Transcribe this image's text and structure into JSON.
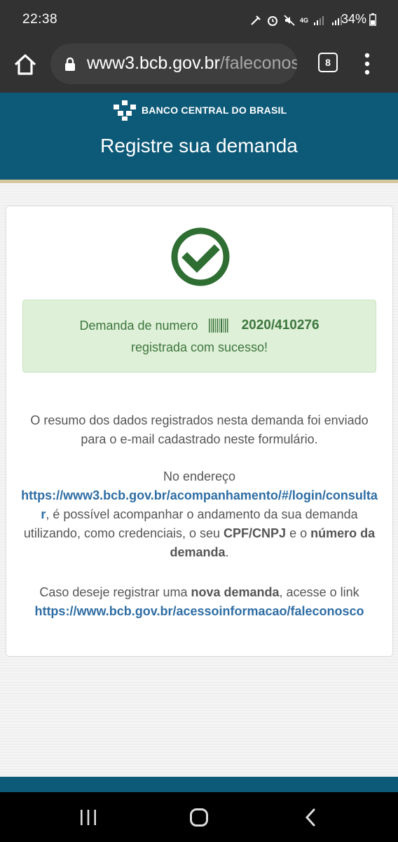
{
  "status": {
    "time": "22:38",
    "battery": "34%",
    "network": "4G"
  },
  "browser": {
    "url_host": "www3.bcb.gov.br",
    "url_path": "/faleconosco",
    "tab_count": "8"
  },
  "header": {
    "logo_text": "BANCO CENTRAL DO BRASIL",
    "title": "Registre sua demanda"
  },
  "alert": {
    "prefix": "Demanda de numero",
    "number": "2020/410276",
    "suffix": "registrada com sucesso!"
  },
  "content": {
    "p1": "O resumo dos dados registrados nesta demanda foi enviado para o e-mail cadastrado neste formulário.",
    "p2_intro": "No endereço",
    "p2_link": "https://www3.bcb.gov.br/acompanhamento/#/login/consultar",
    "p2_mid": ", é possível acompanhar o andamento da sua demanda utilizando, como credenciais, o seu ",
    "p2_cpf": "CPF/CNPJ",
    "p2_and": " e o ",
    "p2_num": "número da demanda",
    "p2_end": ".",
    "p3_intro": "Caso deseje registrar uma ",
    "p3_bold": "nova demanda",
    "p3_mid": ", acesse o link",
    "p3_link": "https://www.bcb.gov.br/acessoinformacao/faleconosco"
  },
  "colors": {
    "header": "#0d5a78",
    "success": "#2e7d32",
    "link": "#2e6da4"
  }
}
